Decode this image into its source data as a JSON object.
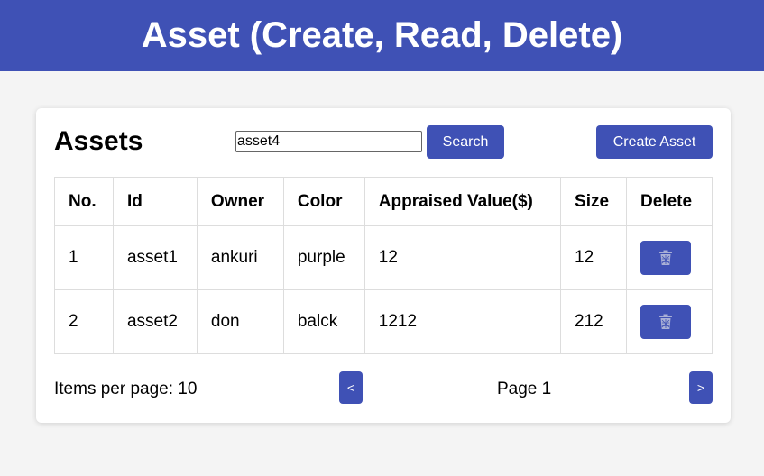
{
  "header": {
    "title": "Asset (Create, Read, Delete)"
  },
  "card": {
    "title": "Assets",
    "search": {
      "value": "asset4",
      "button_label": "Search"
    },
    "create_button_label": "Create Asset"
  },
  "table": {
    "columns": [
      "No.",
      "Id",
      "Owner",
      "Color",
      "Appraised Value($)",
      "Size",
      "Delete"
    ],
    "rows": [
      {
        "no": "1",
        "id": "asset1",
        "owner": "ankuri",
        "color": "purple",
        "value": "12",
        "size": "12"
      },
      {
        "no": "2",
        "id": "asset2",
        "owner": "don",
        "color": "balck",
        "value": "1212",
        "size": "212"
      }
    ],
    "delete_icon": "trash-icon"
  },
  "pagination": {
    "items_per_page_label": "Items per page: 10",
    "page_label": "Page 1",
    "prev_label": "<",
    "next_label": ">"
  },
  "colors": {
    "accent": "#3f51b5",
    "background": "#f4f4f4",
    "card": "#ffffff"
  }
}
